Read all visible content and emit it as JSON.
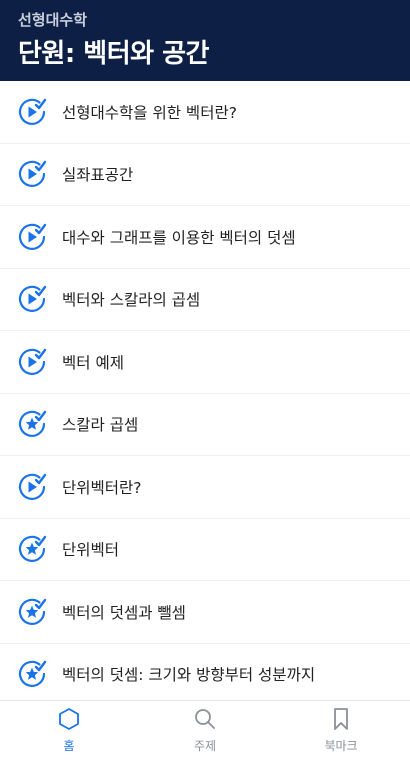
{
  "header": {
    "subject": "선형대수학",
    "unit_title": "단원: 벡터와 공간"
  },
  "lessons": [
    {
      "title": "선형대수학을 위한 벡터란?",
      "icon": "video-complete-icon"
    },
    {
      "title": "실좌표공간",
      "icon": "video-complete-icon"
    },
    {
      "title": "대수와 그래프를 이용한 벡터의 덧셈",
      "icon": "video-complete-icon"
    },
    {
      "title": "벡터와 스칼라의 곱셈",
      "icon": "video-complete-icon"
    },
    {
      "title": "벡터 예제",
      "icon": "video-complete-icon"
    },
    {
      "title": "스칼라 곱셈",
      "icon": "exercise-complete-icon"
    },
    {
      "title": "단위벡터란?",
      "icon": "video-complete-icon"
    },
    {
      "title": "단위벡터",
      "icon": "exercise-complete-icon"
    },
    {
      "title": "벡터의 덧셈과 뺄셈",
      "icon": "exercise-complete-icon"
    },
    {
      "title": "벡터의 덧셈: 크기와 방향부터 성분까지",
      "icon": "exercise-complete-icon"
    }
  ],
  "tabs": [
    {
      "label": "홈",
      "icon": "home-hexagon-icon",
      "active": true
    },
    {
      "label": "주제",
      "icon": "search-icon",
      "active": false
    },
    {
      "label": "북마크",
      "icon": "bookmark-icon",
      "active": false
    }
  ],
  "colors": {
    "header_bg": "#0d1f45",
    "accent": "#1a73e8",
    "tab_inactive": "#8a8f98"
  }
}
